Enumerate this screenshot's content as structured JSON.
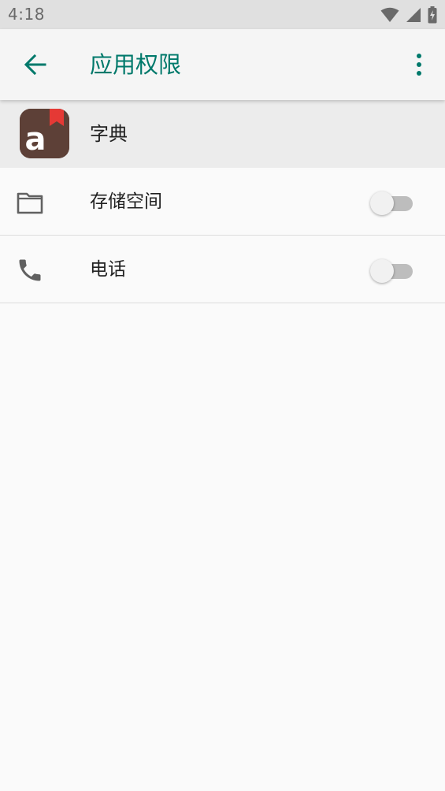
{
  "status_bar": {
    "time": "4:18"
  },
  "app_bar": {
    "title": "应用权限"
  },
  "app": {
    "name": "字典",
    "icon_letter": "a"
  },
  "permissions": [
    {
      "label": "存储空间",
      "icon": "folder-icon",
      "enabled": false
    },
    {
      "label": "电话",
      "icon": "phone-icon",
      "enabled": false
    }
  ],
  "colors": {
    "accent": "#00796b",
    "app_icon_bg": "#5d4037",
    "bookmark": "#e53935"
  }
}
